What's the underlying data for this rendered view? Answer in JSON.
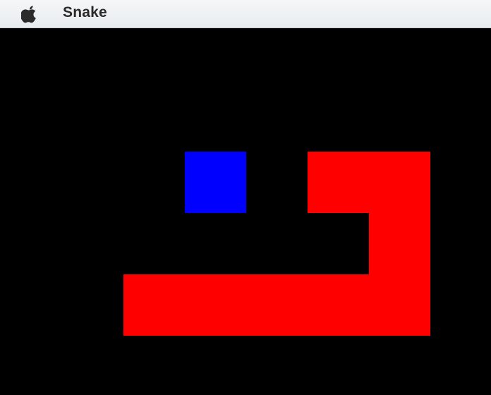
{
  "menubar": {
    "app_name": "Snake",
    "apple_icon": "apple-logo-icon"
  },
  "game": {
    "colors": {
      "background": "#000000",
      "snake": "#ff0000",
      "food": "#0000ff"
    },
    "grid": {
      "columns": 8,
      "rows": 6
    },
    "food": {
      "col": 3,
      "row": 2
    },
    "snake": [
      {
        "col": 5,
        "row": 2
      },
      {
        "col": 6,
        "row": 2
      },
      {
        "col": 6,
        "row": 3
      },
      {
        "col": 6,
        "row": 4
      },
      {
        "col": 5,
        "row": 4
      },
      {
        "col": 4,
        "row": 4
      },
      {
        "col": 3,
        "row": 4
      },
      {
        "col": 2,
        "row": 4
      }
    ]
  }
}
